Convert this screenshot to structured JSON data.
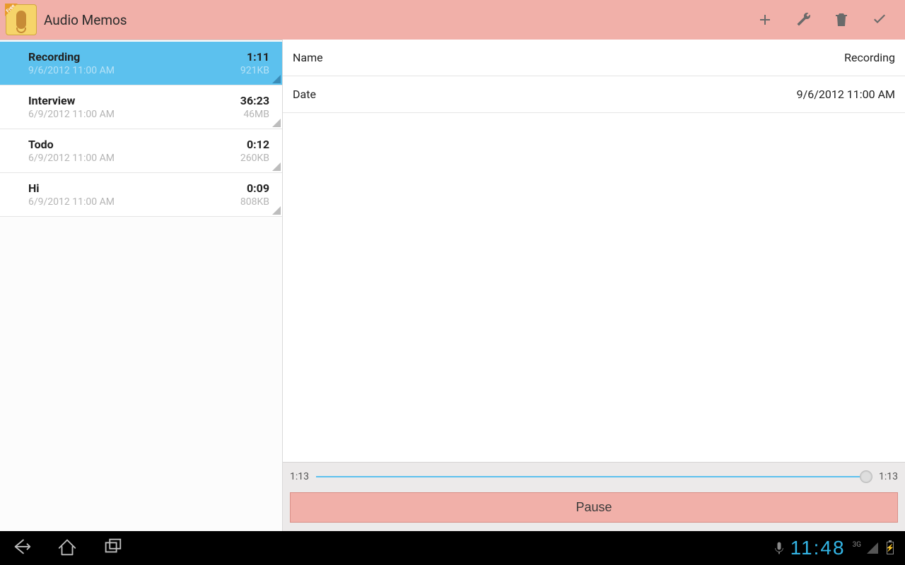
{
  "app": {
    "title": "Audio Memos",
    "ribbon": "Free"
  },
  "toolbar": {
    "add": "+",
    "settings": "settings",
    "delete": "delete",
    "done": "done"
  },
  "recordings": [
    {
      "title": "Recording",
      "datetime": "9/6/2012 11:00 AM",
      "duration": "1:11",
      "size": "921KB",
      "selected": true
    },
    {
      "title": "Interview",
      "datetime": "6/9/2012 11:00 AM",
      "duration": "36:23",
      "size": "46MB",
      "selected": false
    },
    {
      "title": "Todo",
      "datetime": "6/9/2012 11:00 AM",
      "duration": "0:12",
      "size": "260KB",
      "selected": false
    },
    {
      "title": "Hi",
      "datetime": "6/9/2012 11:00 AM",
      "duration": "0:09",
      "size": "808KB",
      "selected": false
    }
  ],
  "detail": {
    "name_label": "Name",
    "name_value": "Recording",
    "date_label": "Date",
    "date_value": "9/6/2012 11:00 AM"
  },
  "player": {
    "elapsed": "1:13",
    "total": "1:13",
    "progress_pct": 99,
    "button_label": "Pause"
  },
  "system": {
    "clock": "11:48",
    "network": "3G"
  }
}
